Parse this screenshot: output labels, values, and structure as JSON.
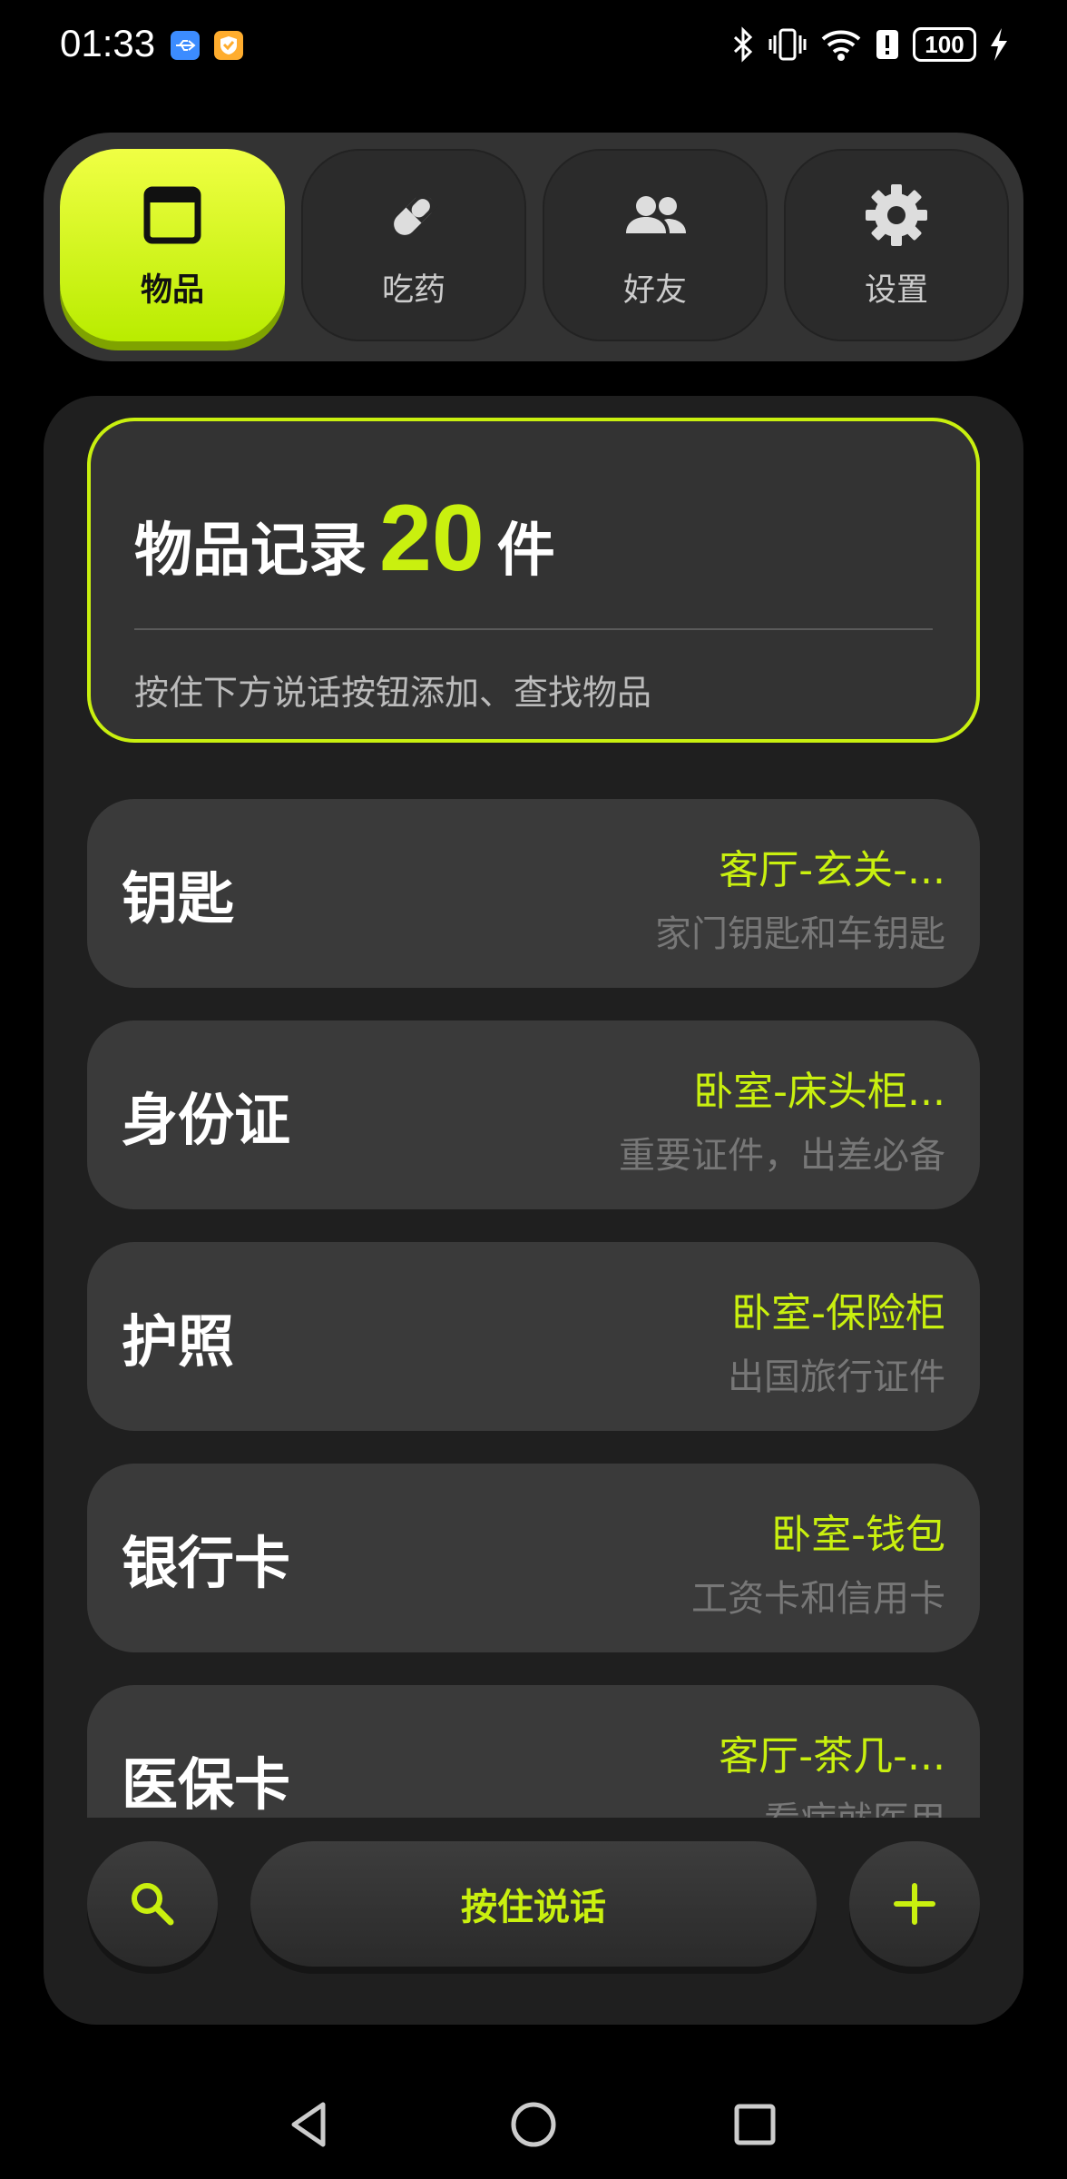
{
  "status_bar": {
    "time": "01:33",
    "battery": "100",
    "notification_icons": [
      "usb-icon",
      "shield-icon"
    ],
    "right_icons": [
      "bluetooth-icon",
      "vibrate-icon",
      "wifi-icon",
      "alert-icon",
      "battery-icon",
      "charging-icon"
    ]
  },
  "tabs": [
    {
      "label": "物品",
      "icon": "item-icon",
      "active": true
    },
    {
      "label": "吃药",
      "icon": "pill-icon",
      "active": false
    },
    {
      "label": "好友",
      "icon": "friends-icon",
      "active": false
    },
    {
      "label": "设置",
      "icon": "gear-icon",
      "active": false
    }
  ],
  "summary": {
    "title_prefix": "物品记录",
    "count": "20",
    "title_suffix": "件",
    "hint": "按住下方说话按钮添加、查找物品"
  },
  "items": [
    {
      "name": "钥匙",
      "location": "客厅-玄关-...",
      "description": "家门钥匙和车钥匙"
    },
    {
      "name": "身份证",
      "location": "卧室-床头柜...",
      "description": "重要证件，出差必备"
    },
    {
      "name": "护照",
      "location": "卧室-保险柜",
      "description": "出国旅行证件"
    },
    {
      "name": "银行卡",
      "location": "卧室-钱包",
      "description": "工资卡和信用卡"
    },
    {
      "name": "医保卡",
      "location": "客厅-茶几-...",
      "description": "看病就医用"
    }
  ],
  "bottom_bar": {
    "talk_label": "按住说话"
  },
  "colors": {
    "accent": "#c9f00f",
    "background": "#000000",
    "card": "#3a3a3a"
  }
}
